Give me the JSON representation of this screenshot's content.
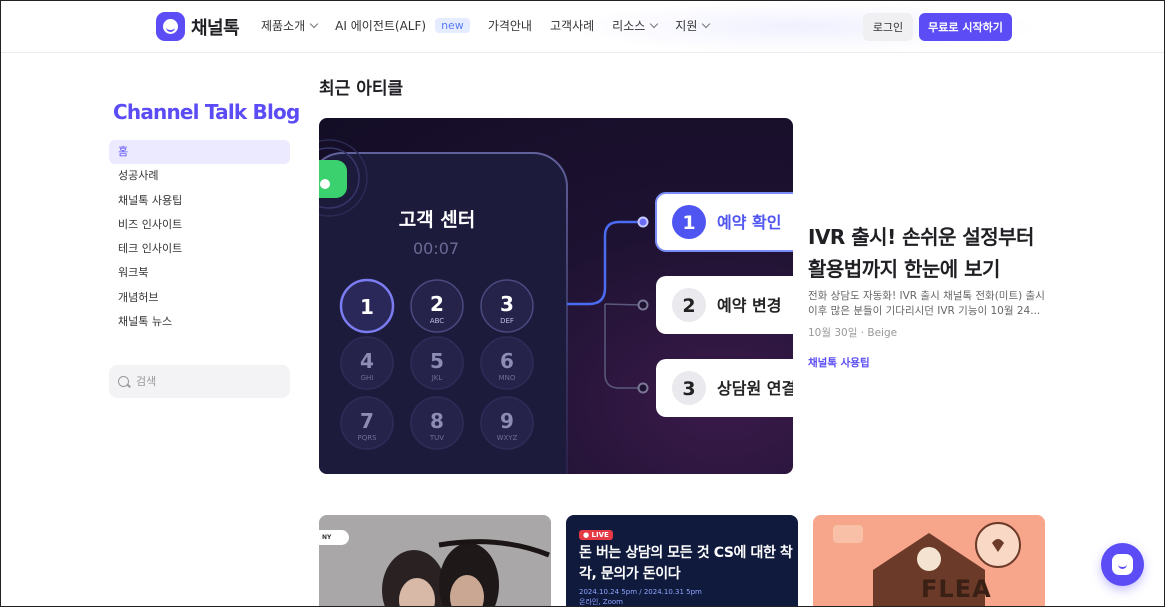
{
  "header": {
    "logo_text": "채널톡",
    "nav": [
      {
        "label": "제품소개",
        "has_dropdown": true
      },
      {
        "label": "AI 에이전트(ALF)",
        "badge": "new"
      },
      {
        "label": "가격안내"
      },
      {
        "label": "고객사례"
      },
      {
        "label": "리소스",
        "has_dropdown": true
      },
      {
        "label": "지원",
        "has_dropdown": true
      }
    ],
    "login_label": "로그인",
    "start_label": "무료로 시작하기"
  },
  "sidebar": {
    "blog_title": "Channel Talk Blog",
    "items": [
      {
        "label": "홈",
        "active": true
      },
      {
        "label": "성공사례"
      },
      {
        "label": "채널톡 사용팁"
      },
      {
        "label": "비즈 인사이트"
      },
      {
        "label": "테크 인사이트"
      },
      {
        "label": "워크북"
      },
      {
        "label": "개념허브"
      },
      {
        "label": "채널톡 뉴스"
      }
    ],
    "search_placeholder": "검색"
  },
  "main": {
    "section_title": "최근 아티클",
    "featured": {
      "image": {
        "phone_title": "고객 센터",
        "phone_timer": "00:07",
        "keypad": [
          {
            "digit": "1",
            "letters": ""
          },
          {
            "digit": "2",
            "letters": "ABC"
          },
          {
            "digit": "3",
            "letters": "DEF"
          },
          {
            "digit": "4",
            "letters": "GHI"
          },
          {
            "digit": "5",
            "letters": "JKL"
          },
          {
            "digit": "6",
            "letters": "MNO"
          },
          {
            "digit": "7",
            "letters": "PQRS"
          },
          {
            "digit": "8",
            "letters": "TUV"
          },
          {
            "digit": "9",
            "letters": "WXYZ"
          }
        ],
        "options": [
          {
            "num": "1",
            "label": "예약 확인"
          },
          {
            "num": "2",
            "label": "예약 변경"
          },
          {
            "num": "3",
            "label": "상담원 연결"
          }
        ]
      },
      "title": "IVR 출시! 손쉬운 설정부터 활용법까지 한눈에 보기",
      "description": "전화 상담도 자동화! IVR 출시 채널톡 전화(미트) 출시 이후 많은 분들이 기다리시던 IVR 기능이 10월 24...",
      "meta": "10월 30일 · Beige",
      "category": "채널톡 사용팁"
    },
    "cards": [
      {
        "tag": "NY"
      },
      {
        "live": "LIVE",
        "title": "돈 버는 상담의 모든 것 CS에 대한 착각, 문의가 돈이다",
        "subtitle": "2024.10.24 5pm / 2024.10.31 5pm",
        "subtitle2": "온라인, Zoom"
      },
      {
        "text": "FLEA"
      }
    ]
  },
  "colors": {
    "brand": "#5b4cf5",
    "text": "#1f1f24"
  }
}
